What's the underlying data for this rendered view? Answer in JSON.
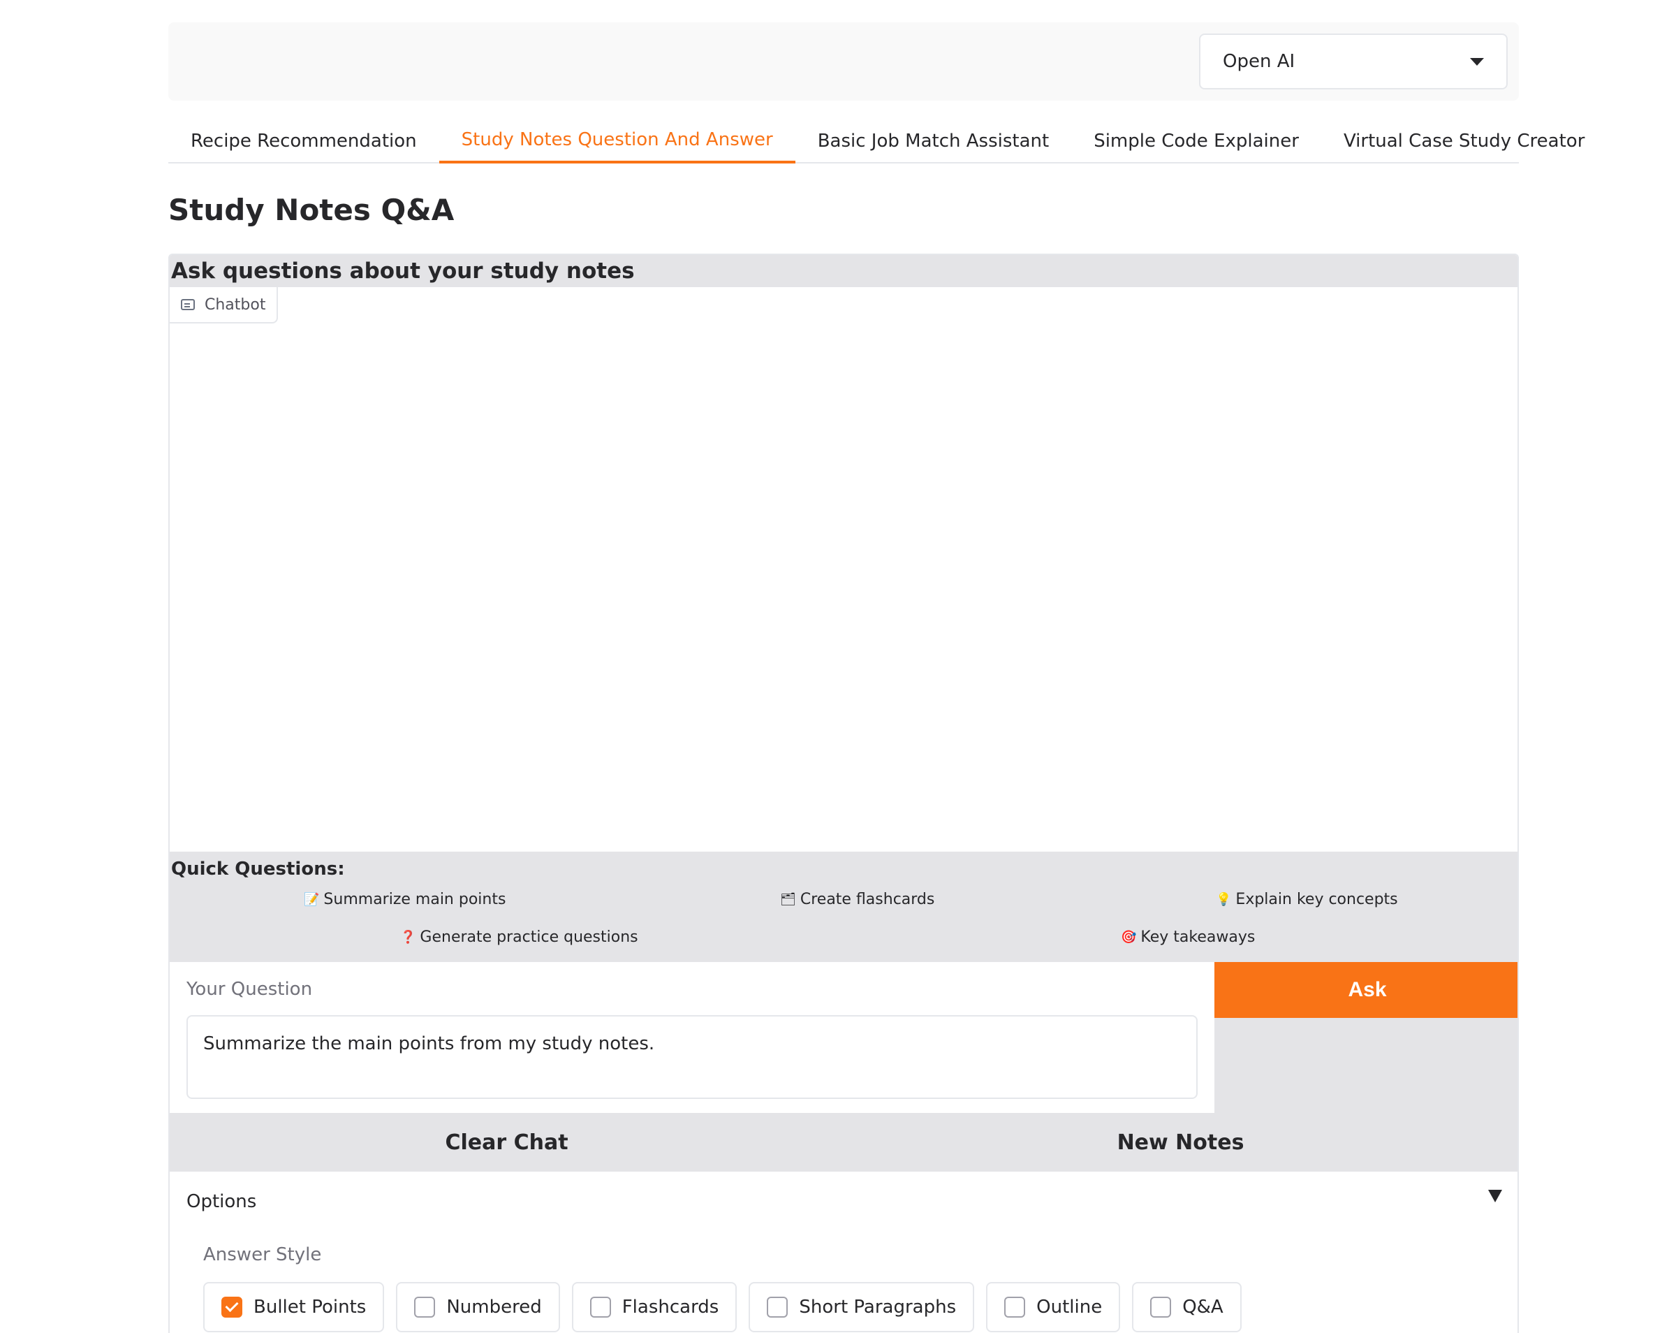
{
  "model_selector": {
    "value": "Open AI"
  },
  "tabs": [
    {
      "label": "Recipe Recommendation"
    },
    {
      "label": "Study Notes Question And Answer"
    },
    {
      "label": "Basic Job Match Assistant"
    },
    {
      "label": "Simple Code Explainer"
    },
    {
      "label": "Virtual Case Study Creator"
    }
  ],
  "page_title": "Study Notes Q&A",
  "chat": {
    "heading": "Ask questions about your study notes",
    "chatbot_label": "Chatbot"
  },
  "quick_questions": {
    "title": "Quick Questions:",
    "items": [
      {
        "emoji": "📝",
        "label": "Summarize main points"
      },
      {
        "emoji": "🗂",
        "label": "Create flashcards"
      },
      {
        "emoji": "💡",
        "label": "Explain key concepts"
      },
      {
        "emoji": "❓",
        "label": "Generate practice questions"
      },
      {
        "emoji": "🎯",
        "label": "Key takeaways"
      }
    ]
  },
  "question": {
    "label": "Your Question",
    "value": "Summarize the main points from my study notes."
  },
  "buttons": {
    "ask": "Ask",
    "clear_chat": "Clear Chat",
    "new_notes": "New Notes"
  },
  "options": {
    "title": "Options",
    "answer_style_label": "Answer Style",
    "answer_styles": [
      {
        "label": "Bullet Points",
        "checked": true
      },
      {
        "label": "Numbered",
        "checked": false
      },
      {
        "label": "Flashcards",
        "checked": false
      },
      {
        "label": "Short Paragraphs",
        "checked": false
      },
      {
        "label": "Outline",
        "checked": false
      },
      {
        "label": "Q&A",
        "checked": false
      }
    ]
  },
  "colors": {
    "accent": "#f97316",
    "panel_gray": "#e4e4e7"
  }
}
